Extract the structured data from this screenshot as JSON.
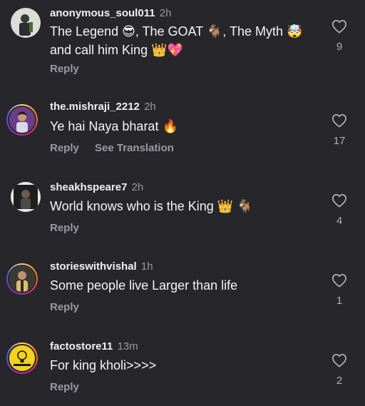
{
  "comments": [
    {
      "username": "anonymous_soul011",
      "time": "2h",
      "text": "The Legend 😎, The GOAT 🐐, The Myth 🤯 and call him King 👑💖",
      "reply": "Reply",
      "likes": "9"
    },
    {
      "username": "the.mishraji_2212",
      "time": "2h",
      "text": "Ye hai Naya bharat 🔥",
      "reply": "Reply",
      "translate": "See Translation",
      "likes": "17"
    },
    {
      "username": "sheakhspeare7",
      "time": "2h",
      "text": "World knows who is the King 👑 🐐",
      "reply": "Reply",
      "likes": "4"
    },
    {
      "username": "storieswithvishal",
      "time": "1h",
      "text": "Some people live Larger than life",
      "reply": "Reply",
      "likes": "1"
    },
    {
      "username": "factostore11",
      "time": "13m",
      "text": "For king kholi>>>>",
      "reply": "Reply",
      "likes": "2"
    }
  ],
  "icons": {
    "like": "heart-outline-icon"
  },
  "colors": {
    "background": "#26262b",
    "secondary_text": "#9a9aa0",
    "primary_text": "#f5f5f5"
  }
}
